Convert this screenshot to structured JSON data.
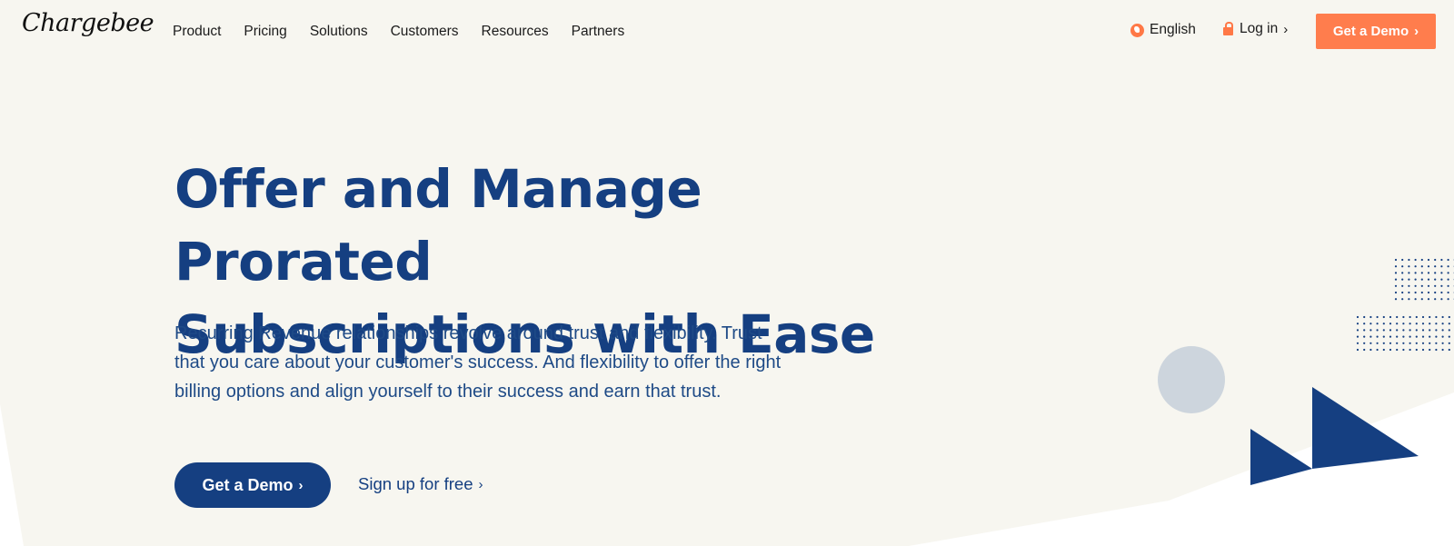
{
  "header": {
    "logo": "Chargebee",
    "nav": [
      "Product",
      "Pricing",
      "Solutions",
      "Customers",
      "Resources",
      "Partners"
    ],
    "language": "English",
    "login": "Log in",
    "demo": "Get a Demo",
    "chevron": "›"
  },
  "hero": {
    "title_line1": "Offer and Manage Prorated",
    "title_line2": "Subscriptions with Ease",
    "description": "Recurring Revenue relationships revolve around trust and flexibility. Trust that you care about your customer's success. And flexibility to offer the right billing options and align yourself to their success and earn that trust.",
    "primary_cta": "Get a Demo",
    "secondary_cta": "Sign up for free"
  },
  "colors": {
    "background": "#f7f6f0",
    "brand_blue": "#153f81",
    "accent_orange": "#ff7d4d",
    "circle_gray": "#cdd5dd"
  },
  "icons": [
    "globe-icon",
    "lock-icon",
    "chevron-right-icon"
  ]
}
